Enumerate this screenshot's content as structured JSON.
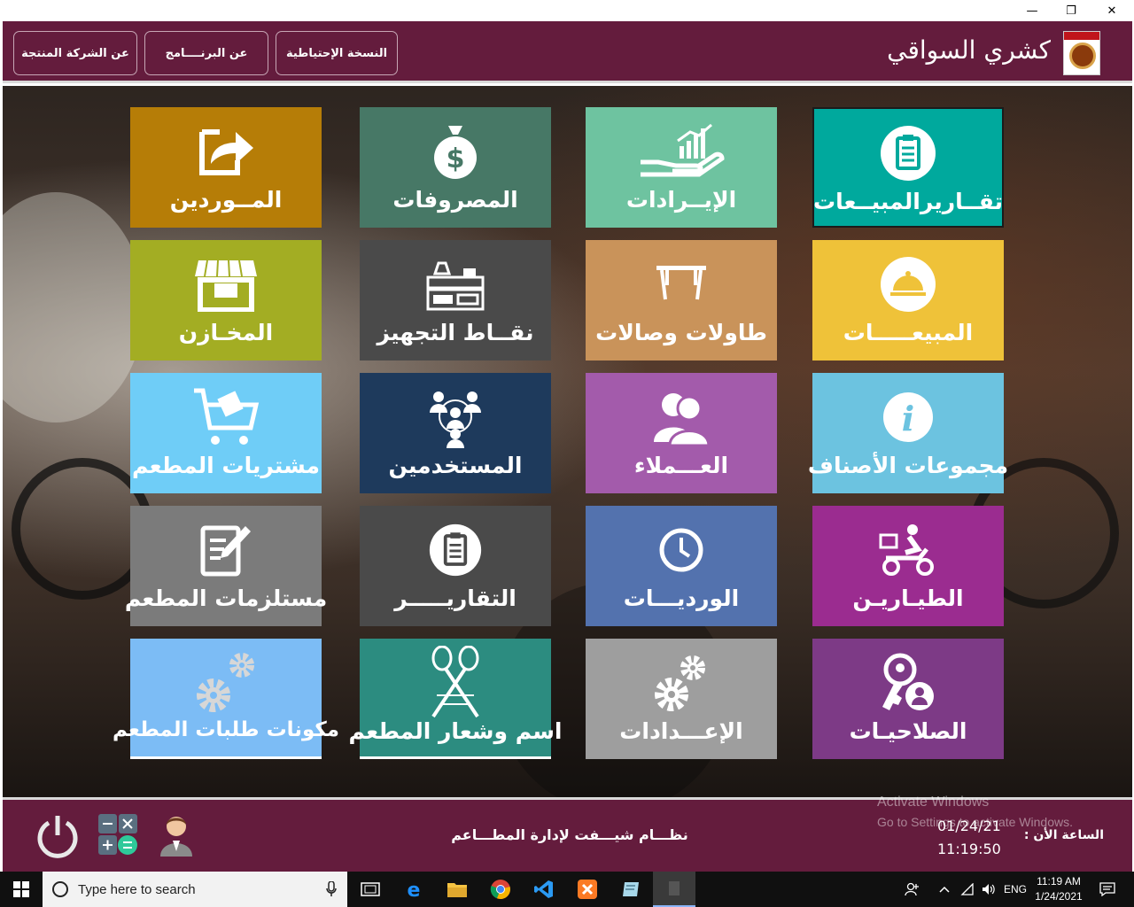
{
  "window": {
    "minimize": "—",
    "restore": "❐",
    "close": "✕"
  },
  "header": {
    "title": "كشري السواقي",
    "buttons": {
      "company": "عن الشركة المنتجة",
      "program": "عن البرنــــامج",
      "backup": "النسخة الإحتياطية"
    }
  },
  "tiles": {
    "suppliers": "المــوردين",
    "expenses": "المصروفات",
    "revenues": "الإيــرادات",
    "sales_reports": "تقــاريرالمبيــعات",
    "stores": "المخـازن",
    "prep_points": "نقــاط التجهيز",
    "tables_halls": "طاولات وصالات",
    "sales": "المبيعـــــات",
    "restaurant_purchases": "مشتريات المطعم",
    "users": "المستخدمين",
    "customers": "العـــملاء",
    "item_groups": "مجموعات الأصناف",
    "restaurant_supplies": "مستلزمات المطعم",
    "reports": "التقاريـــــر",
    "shifts": "الورديـــات",
    "delivery": "الطيـاريـن",
    "order_components": "مكونات طلبات المطعم",
    "name_logo": "اسم وشعار المطعم",
    "settings": "الإعـــدادات",
    "permissions": "الصلاحيـات"
  },
  "colors": {
    "suppliers": "#b67d07",
    "expenses": "#477866",
    "revenues": "#6ec3a0",
    "sales_reports": "#00a99d",
    "stores": "#a3ad23",
    "prep_points": "#4a4a4a",
    "tables_halls": "#c9935a",
    "sales": "#efc239",
    "restaurant_purchases": "#6fcdf7",
    "users": "#1e3a5c",
    "customers": "#a35bab",
    "item_groups": "#6cc3e0",
    "restaurant_supplies": "#7b7b7b",
    "reports": "#4a4a4a",
    "shifts": "#5372ae",
    "delivery": "#9b2c90",
    "order_components": "#7cbcf5",
    "name_logo": "#2c8c80",
    "settings": "#9e9e9e",
    "permissions": "#7d3a86"
  },
  "footer": {
    "system_name": "نظـــام شيـــفت لإدارة المطـــاعم",
    "clock_label": "الساعة الأن :",
    "date": "01/24/21",
    "time": "11:19:50"
  },
  "watermark": {
    "line1": "Activate Windows",
    "line2": "Go to Settings to activate Windows."
  },
  "taskbar": {
    "search_placeholder": "Type here to search",
    "lang": "ENG",
    "time": "11:19 AM",
    "date": "1/24/2021"
  }
}
